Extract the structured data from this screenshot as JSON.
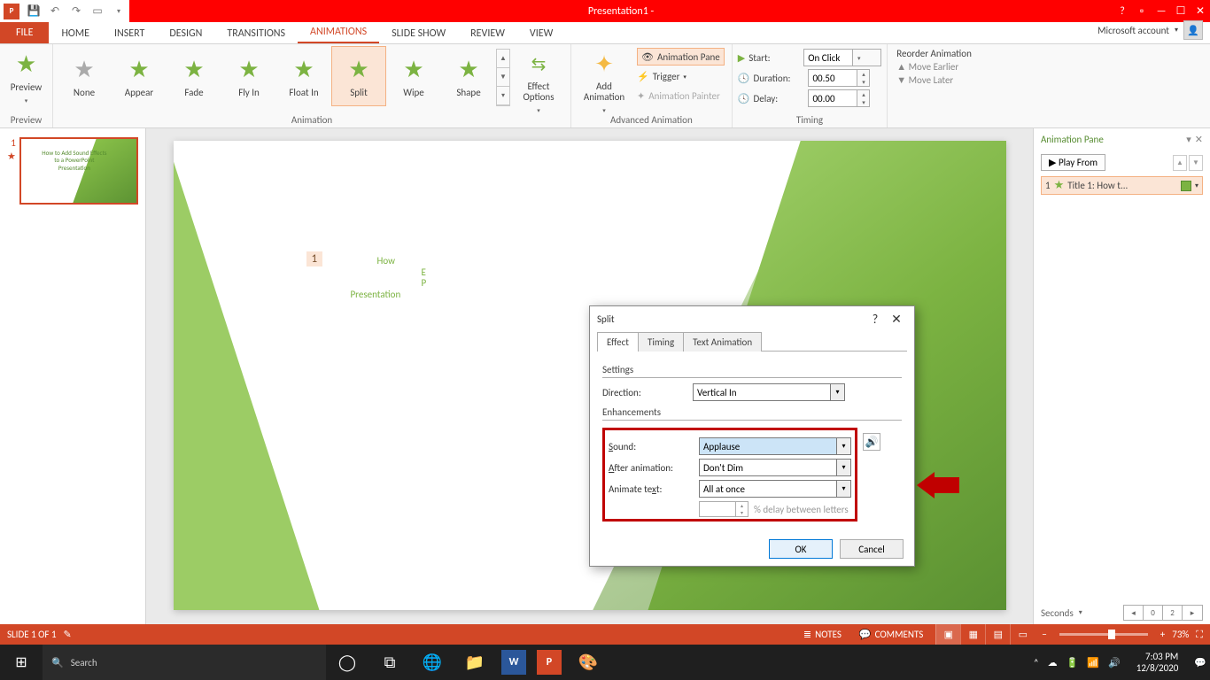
{
  "titlebar": {
    "title": "Presentation1 -"
  },
  "tabs": {
    "file": "FILE",
    "list": [
      "HOME",
      "INSERT",
      "DESIGN",
      "TRANSITIONS",
      "ANIMATIONS",
      "SLIDE SHOW",
      "REVIEW",
      "VIEW"
    ],
    "active_index": 4,
    "account": "Microsoft account"
  },
  "ribbon": {
    "preview": {
      "label": "Preview",
      "group": "Preview"
    },
    "animation": {
      "group": "Animation",
      "items": [
        "None",
        "Appear",
        "Fade",
        "Fly In",
        "Float In",
        "Split",
        "Wipe",
        "Shape"
      ],
      "selected_index": 5,
      "effect_options": "Effect\nOptions"
    },
    "advanced": {
      "group": "Advanced Animation",
      "add": "Add\nAnimation",
      "pane": "Animation Pane",
      "trigger": "Trigger",
      "painter": "Animation Painter"
    },
    "timing": {
      "group": "Timing",
      "start_label": "Start:",
      "start_value": "On Click",
      "duration_label": "Duration:",
      "duration_value": "00.50",
      "delay_label": "Delay:",
      "delay_value": "00.00"
    },
    "reorder": {
      "title": "Reorder Animation",
      "earlier": "Move Earlier",
      "later": "Move Later"
    }
  },
  "animation_pane": {
    "title": "Animation Pane",
    "play": "Play From",
    "item": {
      "index": "1",
      "label": "Title 1: How t..."
    },
    "seconds": "Seconds",
    "nav": [
      "0",
      "2"
    ]
  },
  "slide": {
    "tag": "1",
    "title_lines": [
      "How",
      "E",
      "P",
      "Presentation"
    ],
    "thumb_text": "How to Add Sound Effects to a PowerPoint Presentation"
  },
  "dialog": {
    "title": "Split",
    "help": "?",
    "close": "✕",
    "tabs": [
      "Effect",
      "Timing",
      "Text Animation"
    ],
    "active_tab": 0,
    "settings_label": "Settings",
    "enhancements_label": "Enhancements",
    "direction": {
      "label": "Direction:",
      "value": "Vertical In"
    },
    "sound": {
      "label": "Sound:",
      "value": "Applause"
    },
    "after": {
      "label": "After animation:",
      "value": "Don't Dim"
    },
    "animtext": {
      "label": "Animate text:",
      "value": "All at once"
    },
    "delay_letters": "% delay between letters",
    "ok": "OK",
    "cancel": "Cancel"
  },
  "statusbar": {
    "slide": "SLIDE 1 OF 1",
    "notes": "NOTES",
    "comments": "COMMENTS",
    "zoom": "73%"
  },
  "taskbar": {
    "search_placeholder": "Search",
    "time": "7:03 PM",
    "date": "12/8/2020"
  }
}
